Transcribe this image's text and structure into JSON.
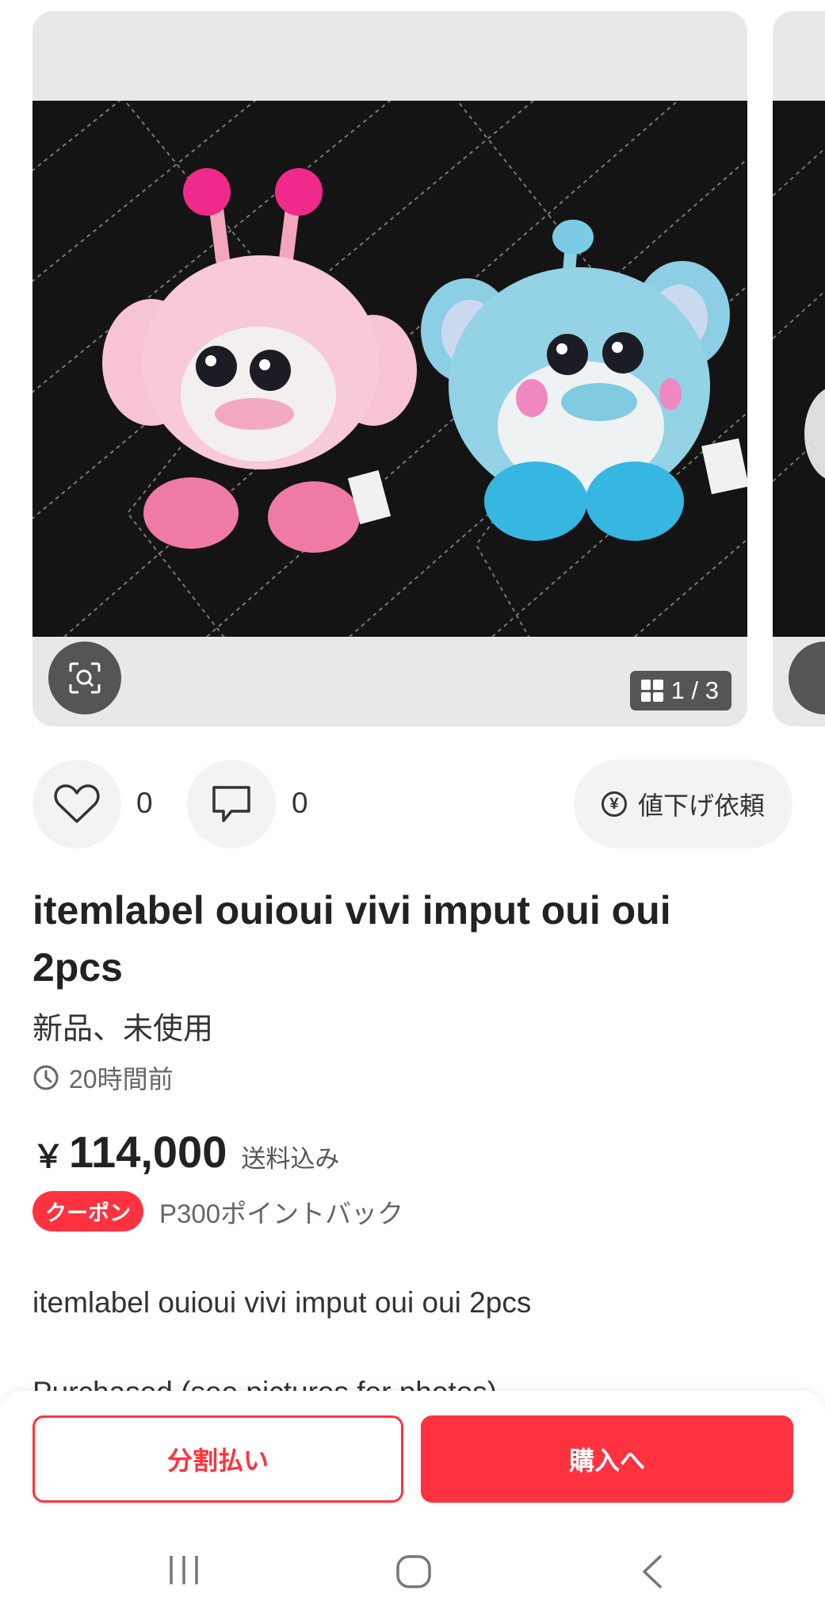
{
  "carousel": {
    "counter": "1 / 3"
  },
  "actions": {
    "like_count": "0",
    "comment_count": "0",
    "price_request_label": "値下げ依頼"
  },
  "item": {
    "title": "itemlabel ouioui vivi imput oui oui 2pcs",
    "condition": "新品、未使用",
    "posted": "20時間前",
    "currency": "￥",
    "price": "114,000",
    "shipping": "送料込み",
    "coupon_label": "クーポン",
    "points": "P300ポイントバック",
    "description_line1": "itemlabel ouioui vivi imput oui oui 2pcs",
    "description_line2": "Purchased (see  pictures for  photos)"
  },
  "bottom": {
    "split_label": "分割払い",
    "buy_label": "購入へ"
  },
  "colors": {
    "accent": "#ff333f",
    "pink_toy": "#f6b4c8",
    "blue_toy": "#8fd3ea"
  },
  "icons": [
    "scan-icon",
    "grid-icon",
    "heart-icon",
    "comment-icon",
    "yen-icon",
    "clock-icon",
    "nav-recents-icon",
    "nav-home-icon",
    "nav-back-icon"
  ]
}
